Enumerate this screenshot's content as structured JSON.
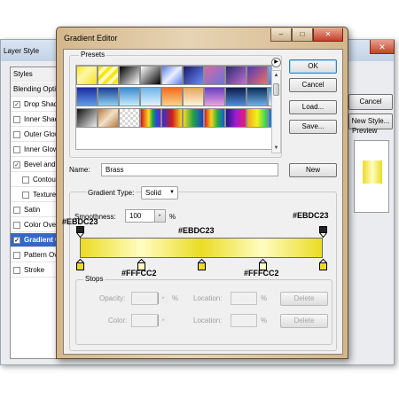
{
  "layer_style": {
    "title": "Layer Style",
    "close_glyph": "✕",
    "items": [
      {
        "label": "Styles",
        "checkbox": false,
        "checked": false,
        "selected": false,
        "indent": 0,
        "header": true
      },
      {
        "label": "Blending Options",
        "checkbox": false,
        "checked": false,
        "selected": false,
        "indent": 0,
        "header": true
      },
      {
        "label": "Drop Shadow",
        "checkbox": true,
        "checked": true,
        "selected": false,
        "indent": 0
      },
      {
        "label": "Inner Shadow",
        "checkbox": true,
        "checked": false,
        "selected": false,
        "indent": 0
      },
      {
        "label": "Outer Glow",
        "checkbox": true,
        "checked": false,
        "selected": false,
        "indent": 0
      },
      {
        "label": "Inner Glow",
        "checkbox": true,
        "checked": false,
        "selected": false,
        "indent": 0
      },
      {
        "label": "Bevel and Emboss",
        "checkbox": true,
        "checked": true,
        "selected": false,
        "indent": 0
      },
      {
        "label": "Contour",
        "checkbox": true,
        "checked": false,
        "selected": false,
        "indent": 1
      },
      {
        "label": "Texture",
        "checkbox": true,
        "checked": false,
        "selected": false,
        "indent": 1
      },
      {
        "label": "Satin",
        "checkbox": true,
        "checked": false,
        "selected": false,
        "indent": 0
      },
      {
        "label": "Color Overlay",
        "checkbox": true,
        "checked": false,
        "selected": false,
        "indent": 0
      },
      {
        "label": "Gradient Overlay",
        "checkbox": true,
        "checked": true,
        "selected": true,
        "indent": 0
      },
      {
        "label": "Pattern Overlay",
        "checkbox": true,
        "checked": false,
        "selected": false,
        "indent": 0
      },
      {
        "label": "Stroke",
        "checkbox": true,
        "checked": false,
        "selected": false,
        "indent": 0
      }
    ],
    "buttons": {
      "cancel": "Cancel",
      "new_style": "New Style...",
      "preview": "Preview"
    }
  },
  "gradient_editor": {
    "title": "Gradient Editor",
    "caption": {
      "minimize": "–",
      "maximize": "□",
      "close": "✕"
    },
    "presets_label": "Presets",
    "menu_glyph": "▶",
    "buttons": {
      "ok": "OK",
      "cancel": "Cancel",
      "load": "Load...",
      "save": "Save...",
      "new": "New"
    },
    "name_label": "Name:",
    "name_value": "Brass",
    "gradient_type_label": "Gradient Type:",
    "gradient_type_value": "Solid",
    "smoothness_label": "Smoothness:",
    "smoothness_value": "100",
    "smoothness_unit": "%",
    "stops_label": "Stops",
    "opacity_label": "Opacity:",
    "color_label": "Color:",
    "location_label": "Location:",
    "location_unit": "%",
    "percent_unit": "%",
    "delete_label": "Delete",
    "scroll_up": "▲",
    "scroll_down": "▼",
    "select_arrow": "▼",
    "stepper_arrow": "▸"
  },
  "presets": [
    {
      "g": "linear-gradient(135deg,#f7e81c,#fff7a8 40%,#f3e11e)"
    },
    {
      "g": "repeating-linear-gradient(135deg,#f6e71b 0 4px,#fff9b8 4px 8px)"
    },
    {
      "g": "linear-gradient(135deg,#000,#fff)"
    },
    {
      "g": "linear-gradient(135deg,#fff 0%,#000 100%)"
    },
    {
      "g": "linear-gradient(135deg,#5a7df0,#e9efff 50%,#5a7df0)"
    },
    {
      "g": "linear-gradient(135deg,#1a1a6a,#6b8dfd)"
    },
    {
      "g": "linear-gradient(135deg,#d56aa3,#6c73d8)"
    },
    {
      "g": "linear-gradient(135deg,#2c2c6c,#c06dd3)"
    },
    {
      "g": "linear-gradient(135deg,#4e3bb0,#f06e6e)"
    },
    {
      "g": "linear-gradient(135deg,#7fb0f4,#3c57b0)"
    },
    {
      "g": "linear-gradient(135deg,#8a3ea5,#e56ca2)"
    },
    {
      "g": "linear-gradient(#1d2aa0,#5f9be8)"
    },
    {
      "g": "linear-gradient(#1b3f8f,#8ed1f3)"
    },
    {
      "g": "linear-gradient(#3a8ad2,#c7ecfc)"
    },
    {
      "g": "linear-gradient(#6fb3e6,#e0f4ff)"
    },
    {
      "g": "linear-gradient(#f26a1b,#fbd28a)"
    },
    {
      "g": "linear-gradient(#e4a55a,#fff4dc)"
    },
    {
      "g": "linear-gradient(#6a3ebf,#e9a3e2)"
    },
    {
      "g": "linear-gradient(#0e1b4a,#4c8bd6)"
    },
    {
      "g": "linear-gradient(#0a2a56,#6cb2e8)"
    },
    {
      "g": "linear-gradient(#3f8fd4,#d9f0ff)"
    },
    {
      "g": "linear-gradient(#87c8f0,#eef9ff)"
    },
    {
      "g": "linear-gradient(135deg,#111,#eee)"
    },
    {
      "g": "linear-gradient(135deg,#b9793b,#f3e0c6 50%,#b9793b)"
    },
    {
      "g": "repeating-conic-gradient(#d6d6d6 0 25%,#ffffff 0 50%) 0 0/6px 6px"
    },
    {
      "g": "linear-gradient(90deg,#d51515,#f07b1b,#f4e21b,#1ba34a,#1a4fd6,#7b1fc0)"
    },
    {
      "g": "linear-gradient(90deg,#2f2fd4,#d21b1b,#f3de1b)"
    },
    {
      "g": "linear-gradient(90deg,#f4da1b,#21a249,#1b3fd4)"
    },
    {
      "g": "linear-gradient(90deg,#e81b1b,#f2d71b,#1fa94a,#1b58d8)"
    },
    {
      "g": "linear-gradient(90deg,#1a1a8a,#a21bd1,#f01b6d)"
    },
    {
      "g": "linear-gradient(90deg,#f3a21b,#f3f31b,#1bd35a)"
    },
    {
      "g": "linear-gradient(90deg,#1b8ad4,#7b1fc0,#d81b5a)"
    },
    {
      "g": "linear-gradient(90deg,#d71b1b,#f3e91b,#1ab24a)"
    }
  ],
  "stops": {
    "color_stop_values": [
      "#EBDC23",
      "#FFFCC2",
      "#EBDC23",
      "#FFFCC2",
      "#EBDC23"
    ],
    "opacity_stop_positions_pct": [
      0,
      100
    ]
  },
  "annotations": {
    "left_top": "#EBDC23",
    "right_top": "#EBDC23",
    "center": "#EBDC23",
    "bottom_left": "#FFFCC2",
    "bottom_right": "#FFFCC2"
  },
  "colors": {
    "stop_dark": "#EBDC23",
    "stop_light": "#FFFCC2"
  }
}
